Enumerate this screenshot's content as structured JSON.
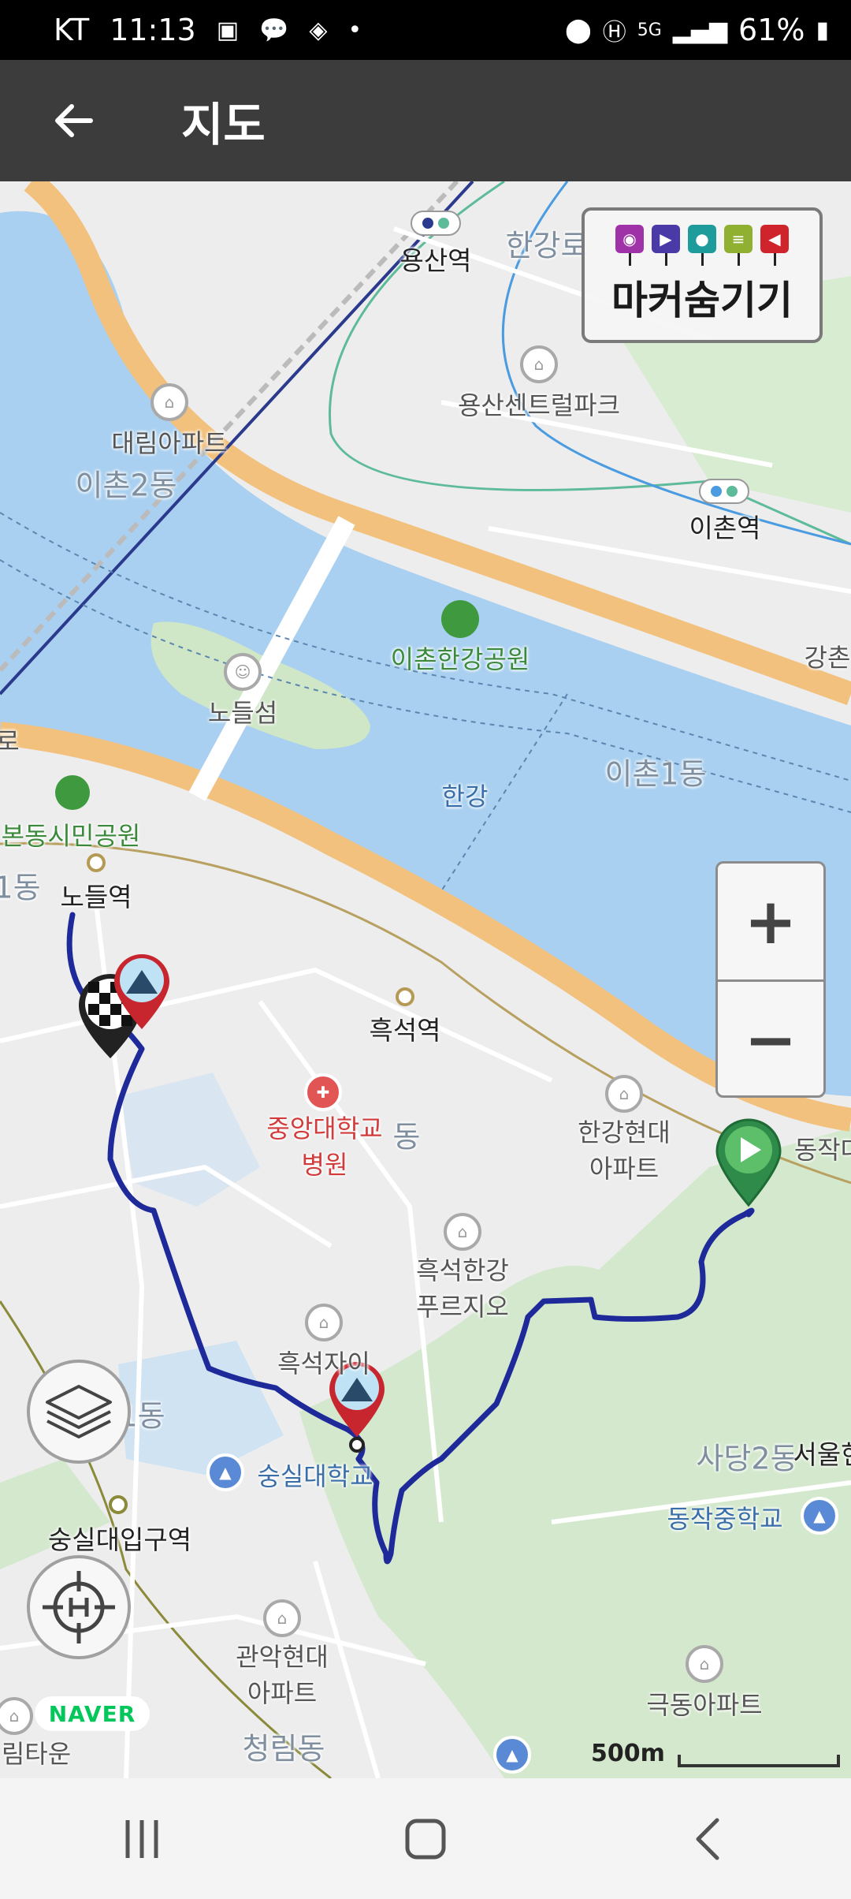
{
  "status_bar": {
    "carrier": "KT",
    "time": "11:13",
    "network": "5G",
    "battery": "61%"
  },
  "app_bar": {
    "title": "지도"
  },
  "map": {
    "places": {
      "yongsan_station": "용산역",
      "hangangro": "한강로",
      "yongsan_central_park": "용산센트럴파크",
      "daerim_apt": "대림아파트",
      "ichon2dong": "이촌2동",
      "ichon_station": "이촌역",
      "ichon_hangang_park": "이촌한강공원",
      "gangchon": "강촌",
      "nodeulseom": "노들섬",
      "hangang": "한강",
      "ichon1dong": "이촌1동",
      "bondong_park": "본동시민공원",
      "ro": "로",
      "dong1": "1동",
      "nodeul_station": "노들역",
      "heukseok_station": "흑석역",
      "cau_hospital": "중앙대학교\n병원",
      "dong": "동",
      "hangang_hyundai_apt": "한강현대\n아파트",
      "dongjak": "동작대",
      "heukseok_hangang_prugio": "흑석한강\n푸르지오",
      "heukseok_xi": "흑석자이",
      "dong_left": "1동",
      "sadang2dong": "사당2동",
      "seoul": "서울현",
      "dongjak_middle_school": "동작중학교",
      "soongsil_univ": "숭실대학교",
      "soongsil_station": "숭실대입구역",
      "gwanak_hyundai_apt": "관악현대\n아파트",
      "geukdong_apt": "극동아파트",
      "cheongnim_dong": "청림동",
      "rim_town": "림타운"
    },
    "marker_hide_label": "마커숨기기",
    "marker_types": [
      "camera-icon",
      "video-icon",
      "mic-icon",
      "memo-icon",
      "flag-icon"
    ],
    "marker_colors": [
      "#a032a8",
      "#4a3aa8",
      "#1e9c9c",
      "#8fb030",
      "#d0242c"
    ],
    "zoom_in": "+",
    "zoom_out": "−",
    "provider": "NAVER",
    "scale": "500m",
    "route_color": "#1f2a9a"
  }
}
